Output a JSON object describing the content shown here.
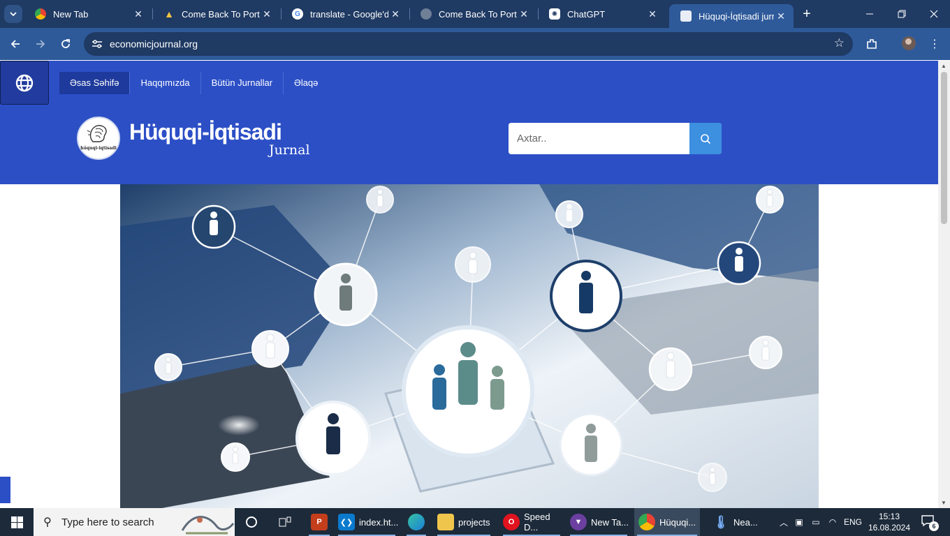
{
  "browser": {
    "tabs": [
      {
        "title": "New Tab",
        "favicon": "chrome-icon"
      },
      {
        "title": "Come Back To Portfolio",
        "favicon": "portfolio-icon"
      },
      {
        "title": "translate - Google'da",
        "favicon": "google-icon"
      },
      {
        "title": "Come Back To Portfolio",
        "favicon": "globe-icon"
      },
      {
        "title": "ChatGPT",
        "favicon": "chatgpt-icon"
      },
      {
        "title": "Hüquqi-İqtisadi jurnal",
        "favicon": "journal-icon"
      }
    ],
    "active_tab_index": 5,
    "url": "economicjournal.org"
  },
  "site": {
    "menu": [
      "Əsas Səhifə",
      "Haqqımızda",
      "Bütün Jurnallar",
      "Əlaqə"
    ],
    "active_menu_index": 0,
    "brand_title": "Hüquqi-İqtisadi",
    "brand_subtitle": "Jurnal",
    "logo_caption": "hüquqi-iqtisadi",
    "search_placeholder": "Axtar..",
    "colors": {
      "header": "#2c4fc6",
      "search_button": "#3d8fe0"
    }
  },
  "taskbar": {
    "search_placeholder": "Type here to search",
    "items": [
      {
        "label": "",
        "icon": "cortana-icon"
      },
      {
        "label": "",
        "icon": "task-view-icon"
      },
      {
        "label": "",
        "icon": "powerpoint-icon"
      },
      {
        "label": "index.ht...",
        "icon": "vscode-icon"
      },
      {
        "label": "",
        "icon": "edge-icon"
      },
      {
        "label": "projects",
        "icon": "folder-icon"
      },
      {
        "label": "Speed D...",
        "icon": "opera-icon"
      },
      {
        "label": "New Ta...",
        "icon": "tor-icon"
      },
      {
        "label": "Hüquqi...",
        "icon": "chrome-icon"
      },
      {
        "label": "Nea...",
        "icon": "weather-icon"
      }
    ],
    "language": "ENG",
    "time": "15:13",
    "date": "16.08.2024",
    "notification_count": "6"
  }
}
